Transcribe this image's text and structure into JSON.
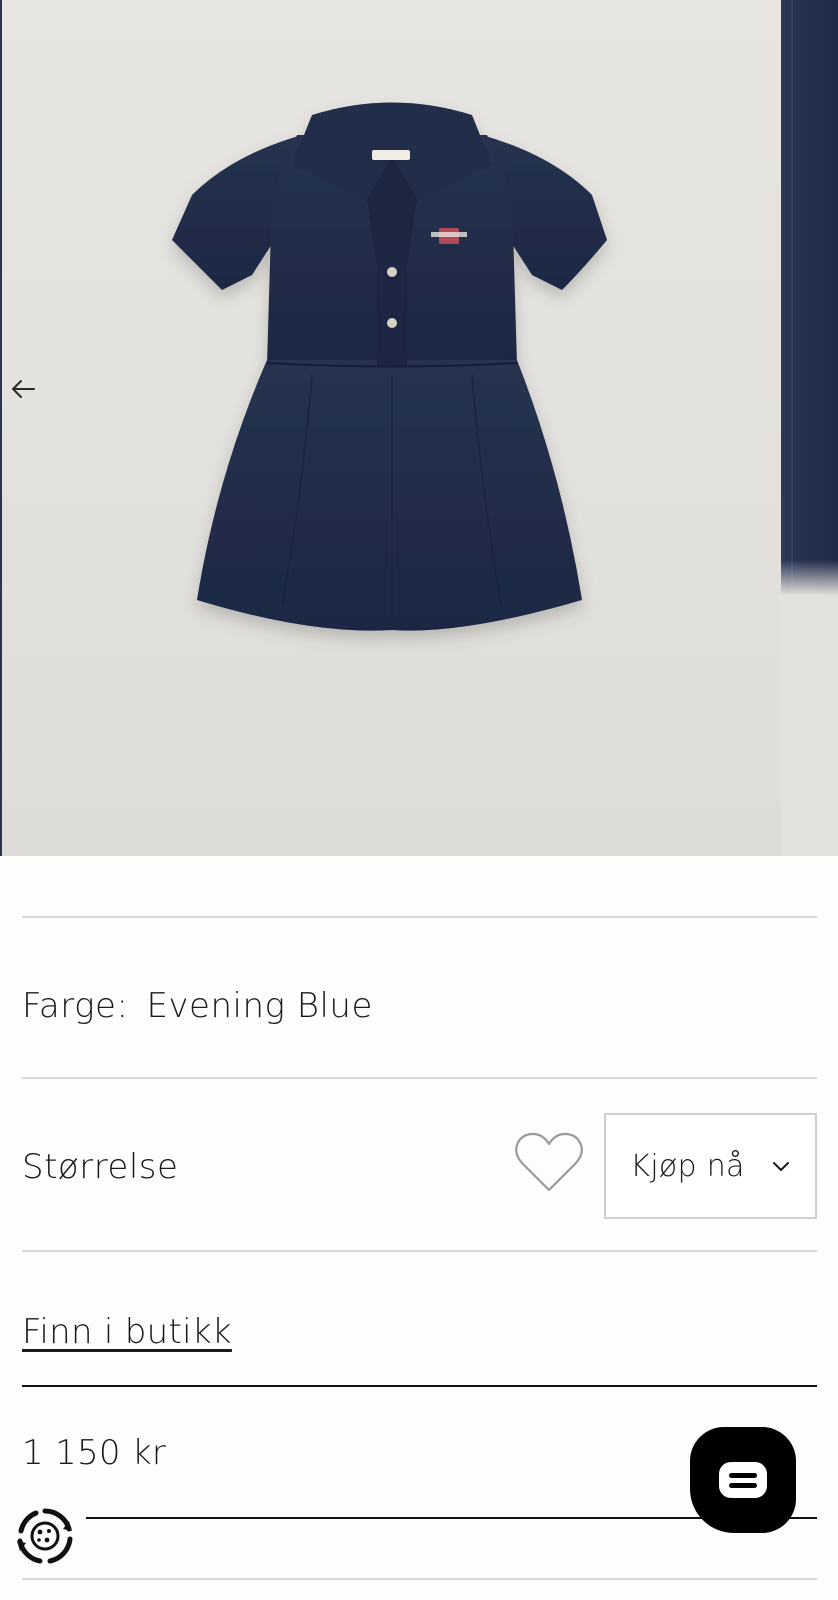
{
  "product": {
    "color_label": "Farge:",
    "color_value": "Evening Blue",
    "size_label": "Størrelse",
    "buy_label": "Kjøp nå",
    "store_link": "Finn i butikk",
    "price": "1 150 kr"
  },
  "gallery": {
    "prev_icon": "arrow-left-icon",
    "brand_mark": "GANT"
  },
  "icons": {
    "wishlist": "heart-icon",
    "buy_dropdown": "chevron-down-icon",
    "chat": "chat-bubble-icon",
    "cookie": "cookie-settings-icon"
  },
  "colors": {
    "dress": "#1f2b45",
    "background": "#e3e2de",
    "text": "#1a1a1a",
    "divider": "#d9d9d7"
  }
}
